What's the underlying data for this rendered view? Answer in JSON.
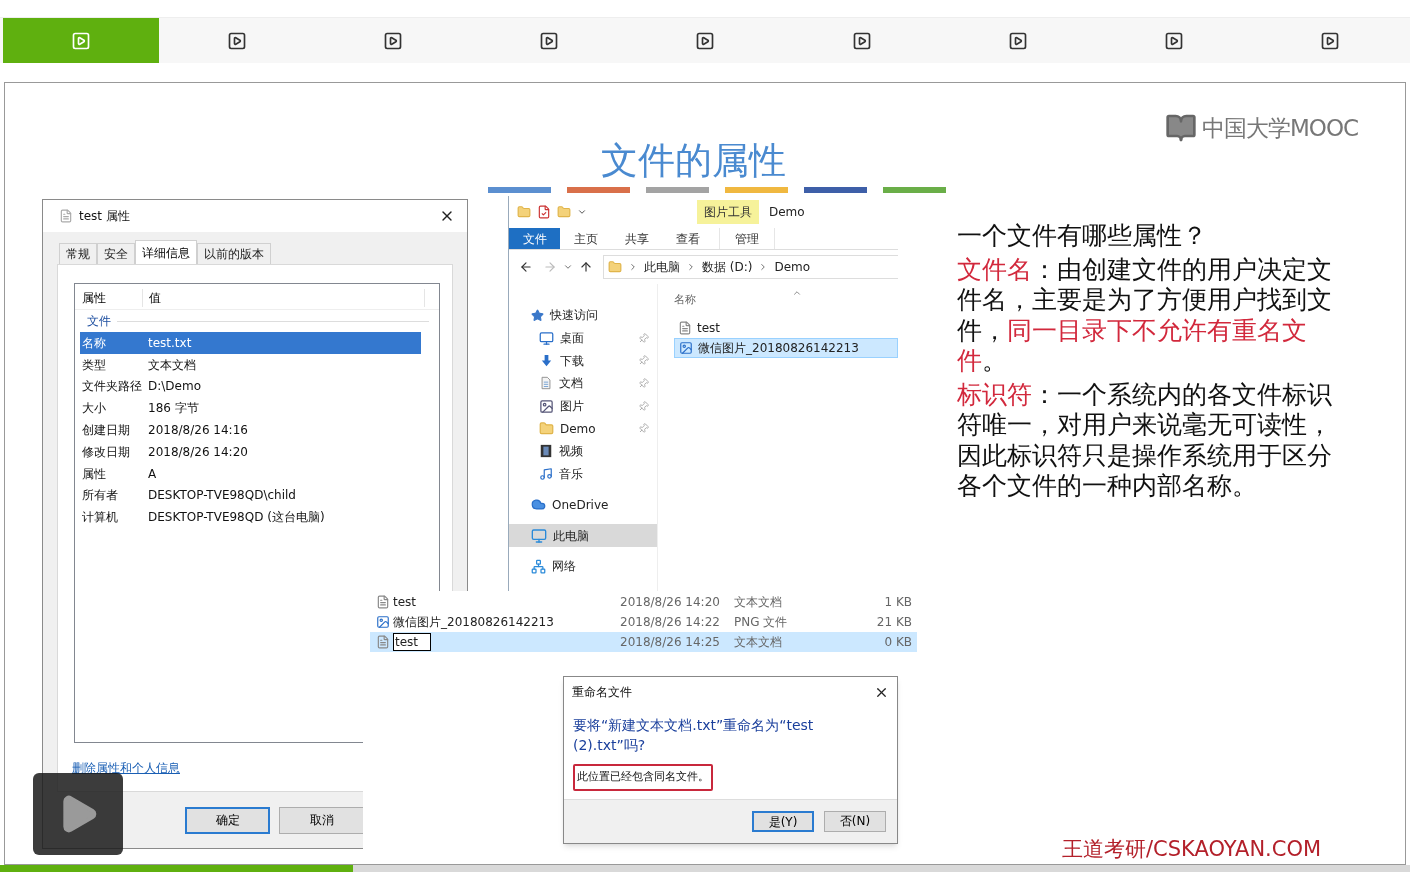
{
  "player": {
    "segments": [
      {
        "selected": true
      },
      {
        "selected": false
      },
      {
        "selected": false
      },
      {
        "selected": false
      },
      {
        "selected": false
      },
      {
        "selected": false
      },
      {
        "selected": false
      },
      {
        "selected": false
      },
      {
        "selected": false
      }
    ]
  },
  "slide": {
    "title": "文件的属性",
    "logo": "中国大学MOOC",
    "accent_bars": [
      {
        "color": "#5b8fd0"
      },
      {
        "color": "#d9704a"
      },
      {
        "color": "#a3a3a3"
      },
      {
        "color": "#f0b840"
      },
      {
        "color": "#3e5fa8"
      },
      {
        "color": "#6aae48"
      }
    ],
    "properties_dialog": {
      "title": "test 属性",
      "tabs": [
        {
          "label": "常规",
          "selected": false
        },
        {
          "label": "安全",
          "selected": false
        },
        {
          "label": "详细信息",
          "selected": true
        },
        {
          "label": "以前的版本",
          "selected": false
        }
      ],
      "columns": [
        "属性",
        "值"
      ],
      "group": "文件",
      "rows": [
        {
          "property": "名称",
          "value": "test.txt",
          "selected": true
        },
        {
          "property": "类型",
          "value": "文本文档",
          "selected": false
        },
        {
          "property": "文件夹路径",
          "value": "D:\\Demo",
          "selected": false
        },
        {
          "property": "大小",
          "value": "186 字节",
          "selected": false
        },
        {
          "property": "创建日期",
          "value": "2018/8/26 14:16",
          "selected": false
        },
        {
          "property": "修改日期",
          "value": "2018/8/26 14:20",
          "selected": false
        },
        {
          "property": "属性",
          "value": "A",
          "selected": false
        },
        {
          "property": "所有者",
          "value": "DESKTOP-TVE98QD\\child",
          "selected": false
        },
        {
          "property": "计算机",
          "value": "DESKTOP-TVE98QD (这台电脑)",
          "selected": false
        }
      ],
      "link": "删除属性和个人信息",
      "buttons": [
        {
          "label": "确定",
          "default": true
        },
        {
          "label": "取消",
          "default": false
        }
      ]
    },
    "explorer": {
      "context_tab": "图片工具",
      "window_title": "Demo",
      "ribbon_tabs": [
        {
          "label": "文件",
          "selected": true
        },
        {
          "label": "主页",
          "selected": false
        },
        {
          "label": "共享",
          "selected": false
        },
        {
          "label": "查看",
          "selected": false
        },
        {
          "label": "管理",
          "selected": false
        }
      ],
      "breadcrumb": [
        "此电脑",
        "数据 (D:)",
        "Demo"
      ],
      "nav": [
        {
          "label": "快速访问",
          "kind": "star",
          "selected": false,
          "children": [
            {
              "label": "桌面",
              "kind": "desktop",
              "selected": false,
              "pinned": true
            },
            {
              "label": "下载",
              "kind": "download",
              "selected": false,
              "pinned": true
            },
            {
              "label": "文档",
              "kind": "document",
              "selected": false,
              "pinned": true
            },
            {
              "label": "图片",
              "kind": "picture",
              "selected": false,
              "pinned": true
            },
            {
              "label": "Demo",
              "kind": "folder",
              "selected": false,
              "pinned": true
            },
            {
              "label": "视频",
              "kind": "video",
              "selected": false,
              "pinned": false
            },
            {
              "label": "音乐",
              "kind": "music",
              "selected": false,
              "pinned": false
            }
          ]
        },
        {
          "label": "OneDrive",
          "kind": "cloud",
          "selected": false
        },
        {
          "label": "此电脑",
          "kind": "computer",
          "selected": true
        },
        {
          "label": "网络",
          "kind": "network",
          "selected": false
        }
      ],
      "column": "名称",
      "files": [
        {
          "name": "test",
          "kind": "text",
          "selected": false
        },
        {
          "name": "微信图片_20180826142213",
          "kind": "image",
          "selected": true
        }
      ]
    },
    "file_list": {
      "rows": [
        {
          "name": "test",
          "modified": "2018/8/26 14:20",
          "type": "文本文档",
          "size": "1 KB",
          "kind": "text",
          "selected": false,
          "editing": false
        },
        {
          "name": "微信图片_20180826142213",
          "modified": "2018/8/26 14:22",
          "type": "PNG 文件",
          "size": "21 KB",
          "kind": "image",
          "selected": false,
          "editing": false
        },
        {
          "name": "test",
          "modified": "2018/8/26 14:25",
          "type": "文本文档",
          "size": "0 KB",
          "kind": "text",
          "selected": true,
          "editing": true
        }
      ]
    },
    "rename_dialog": {
      "title": "重命名文件",
      "message": "要将“新建文本文档.txt”重命名为“test (2).txt”吗?",
      "detail": "此位置已经包含同名文件。",
      "buttons": [
        {
          "label": "是(Y)",
          "default": true
        },
        {
          "label": "否(N)",
          "default": false
        }
      ]
    },
    "notes": [
      [
        {
          "text": "一个文件有哪些属性？",
          "highlight": false
        }
      ],
      [
        {
          "text": "文件名",
          "highlight": true
        },
        {
          "text": "：由创建文件的用户决定文件名，主要是为了方便用户找到文件，",
          "highlight": false
        },
        {
          "text": "同一目录下不允许有重名文件",
          "highlight": true
        },
        {
          "text": "。",
          "highlight": false
        }
      ],
      [
        {
          "text": "标识符",
          "highlight": true
        },
        {
          "text": "：一个系统内的各文件标识符唯一，对用户来说毫无可读性，因此标识符只是操作系统用于区分各个文件的一种内部名称。",
          "highlight": false
        }
      ]
    ],
    "footer": "王道考研/CSKAOYAN.COM"
  },
  "progress": {
    "level": 0.25
  }
}
